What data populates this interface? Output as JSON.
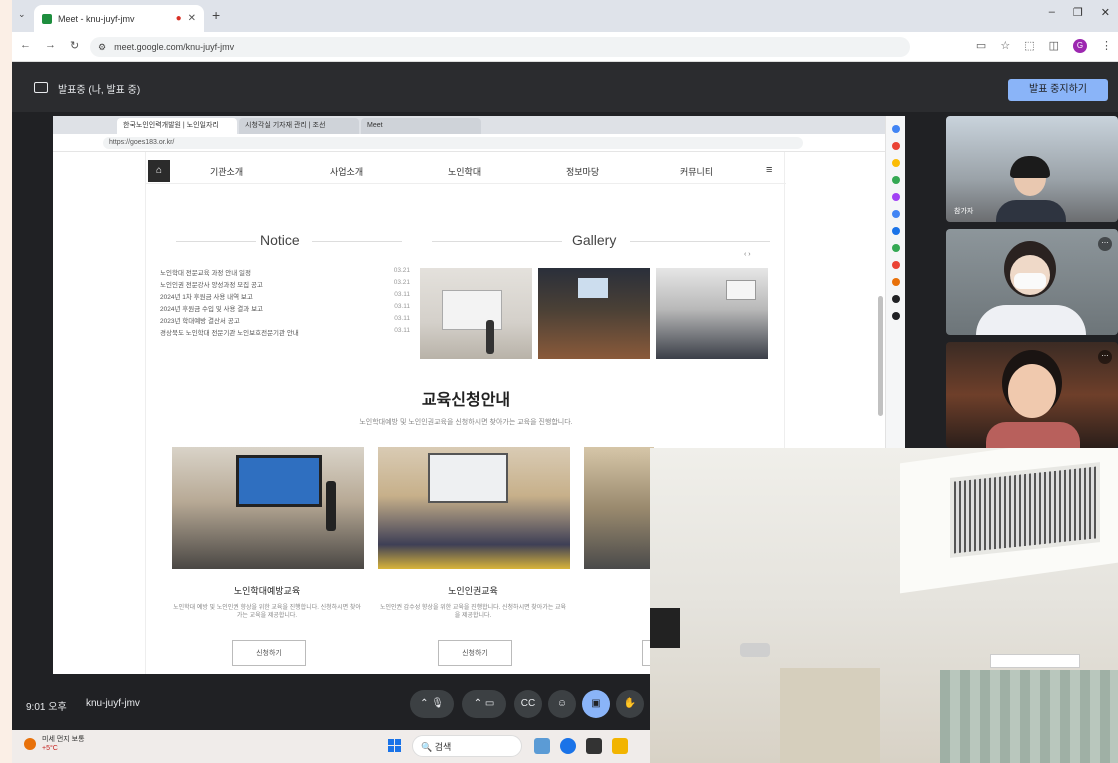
{
  "browser": {
    "tab_title": "Meet - knu-juyf-jmv",
    "url": "meet.google.com/knu-juyf-jmv"
  },
  "meet": {
    "presenting_label": "발표중 (나, 발표 중)",
    "stop_button": "발표 중지하기",
    "time": "9:01 오후",
    "meeting_code": "knu-juyf-jmv"
  },
  "shared_browser": {
    "tabs": [
      "한국노인인력개발원 | 노인일자리",
      "시청각실 기자재 관리 | 조선",
      "Meet"
    ],
    "url": "https://goes183.or.kr/"
  },
  "site": {
    "nav": [
      "기관소개",
      "사업소개",
      "노인학대",
      "정보마당",
      "커뮤니티"
    ],
    "notice_title": "Notice",
    "gallery_title": "Gallery",
    "notices": [
      {
        "text": "노인학대 전문교육 과정 안내 일정",
        "date": "03.21"
      },
      {
        "text": "노인인권 전문강사 양성과정 모집 공고",
        "date": "03.21"
      },
      {
        "text": "2024년 1차 후원금 사용 내역 보고",
        "date": "03.11"
      },
      {
        "text": "2024년 후원금 수입 및 사용 결과 보고",
        "date": "03.11"
      },
      {
        "text": "2023년 학대예방 결산서 공고",
        "date": "03.11"
      },
      {
        "text": "경상북도 노인학대 전문기관 노인보호전문기관 안내",
        "date": "03.11"
      }
    ],
    "edu_title": "교육신청안내",
    "edu_subtitle": "노인학대예방 및 노인인권교육을 신청하시면 찾아가는 교육을 진행합니다.",
    "cards": [
      {
        "title": "노인학대예방교육",
        "desc": "노인학대 예방 및 노인인권 향상을 위한 교육을 진행합니다. 신청하시면 찾아가는 교육을 제공합니다.",
        "button": "신청하기"
      },
      {
        "title": "노인인권교육",
        "desc": "노인인권 감수성 향상을 위한 교육을 진행합니다. 신청하시면 찾아가는 교육을 제공합니다.",
        "button": "신청하기"
      }
    ]
  },
  "participants": [
    "참가자",
    "",
    ""
  ],
  "taskbar": {
    "weather_line1": "미세 먼지 보통",
    "weather_line2": "+5°C",
    "search_placeholder": "검색"
  },
  "colors": {
    "meet_bg": "#202124",
    "accent": "#8ab4f8",
    "tab_recording": "#d93025"
  }
}
